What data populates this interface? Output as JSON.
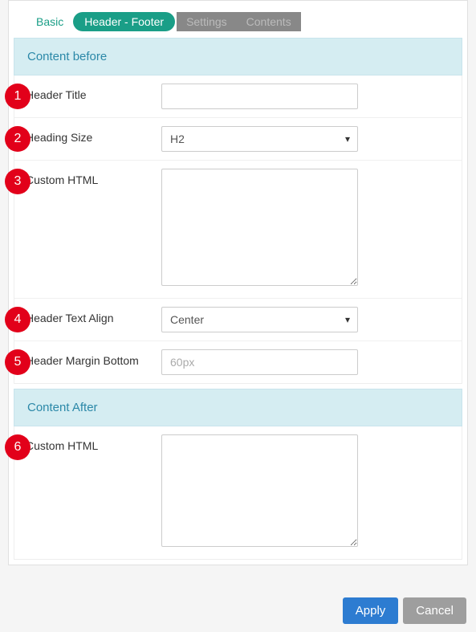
{
  "tabs": {
    "basic": "Basic",
    "header_footer": "Header - Footer",
    "settings": "Settings",
    "contents": "Contents"
  },
  "sections": {
    "before": "Content before",
    "after": "Content After"
  },
  "fields": {
    "header_title": {
      "label": "Header Title",
      "value": ""
    },
    "heading_size": {
      "label": "Heading Size",
      "value": "H2"
    },
    "custom_html_before": {
      "label": "Custom HTML",
      "value": ""
    },
    "header_text_align": {
      "label": "Header Text Align",
      "value": "Center"
    },
    "header_margin_bottom": {
      "label": "Header Margin Bottom",
      "placeholder": "60px",
      "value": ""
    },
    "custom_html_after": {
      "label": "Custom HTML",
      "value": ""
    }
  },
  "badges": {
    "b1": "1",
    "b2": "2",
    "b3": "3",
    "b4": "4",
    "b5": "5",
    "b6": "6"
  },
  "actions": {
    "apply": "Apply",
    "cancel": "Cancel"
  }
}
